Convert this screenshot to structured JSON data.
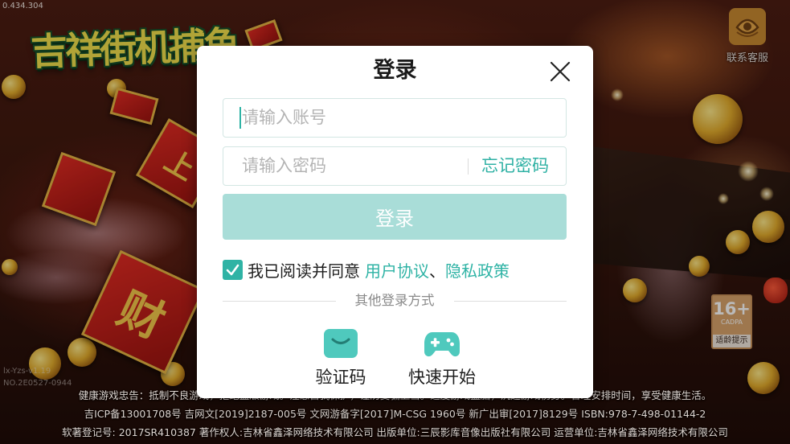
{
  "version_text": "0.434.304",
  "background": {
    "logo_text": "吉祥街机捕鱼",
    "decor_up": "上",
    "decor_wealth": "财",
    "build_info": [
      "lx-Yzs-v1.19",
      "NO.2E0527-0944"
    ]
  },
  "support": {
    "icon": "headset-icon",
    "label": "联系客服"
  },
  "age_rating": {
    "rating": "16+",
    "org": "CADPA",
    "label": "适龄提示"
  },
  "login_dialog": {
    "title": "登录",
    "close_icon": "close-icon",
    "account": {
      "placeholder": "请输入账号",
      "value": ""
    },
    "password": {
      "placeholder": "请输入密码",
      "value": "",
      "forgot_label": "忘记密码"
    },
    "submit_label": "登录",
    "agreement": {
      "checked": true,
      "prefix": "我已阅读并同意",
      "user_agreement": "用户协议",
      "separator": "、",
      "privacy_policy": "隐私政策"
    },
    "other_methods": {
      "heading": "其他登录方式",
      "options": [
        {
          "icon": "envelope-icon",
          "label": "验证码"
        },
        {
          "icon": "gamepad-icon",
          "label": "快速开始"
        }
      ]
    }
  },
  "footer": {
    "lines": [
      "健康游戏忠告：抵制不良游戏，拒绝盗版游戏。注意自我保护，谨防受骗上当。适度游戏益脑，沉迷游戏伤身。合理安排时间，享受健康生活。",
      "吉ICP备13001708号 吉网文[2019]2187-005号 文网游备字[2017]M-CSG 1960号 新广出审[2017]8129号 ISBN:978-7-498-01144-2",
      "软著登记号: 2017SR410387 著作权人:吉林省鑫泽网络技术有限公司 出版单位:三辰影库音像出版社有限公司 运营单位:吉林省鑫泽网络技术有限公司"
    ]
  },
  "colors": {
    "accent": "#2fb3a5",
    "submit_disabled": "#a9ddd8",
    "icon_teal": "#4fc9bd",
    "support_orange": "#c98930"
  }
}
